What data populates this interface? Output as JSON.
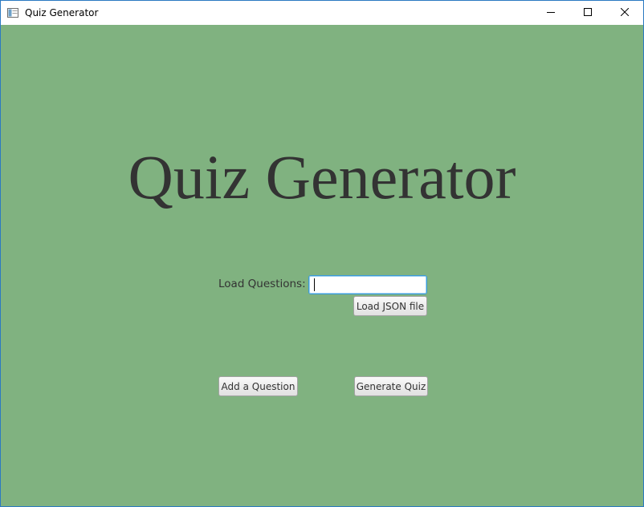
{
  "window": {
    "title": "Quiz Generator",
    "app_icon": "window-app-icon",
    "controls": [
      "minimize-icon",
      "maximize-icon",
      "close-icon"
    ]
  },
  "main": {
    "heading": "Quiz Generator",
    "load_label": "Load Questions:",
    "load_input_value": "",
    "load_json_button": "Load JSON file",
    "add_question_button": "Add a Question",
    "generate_quiz_button": "Generate Quiz"
  },
  "colors": {
    "background": "#80b280",
    "focus_border": "#3a9ad9",
    "text": "#333333"
  }
}
